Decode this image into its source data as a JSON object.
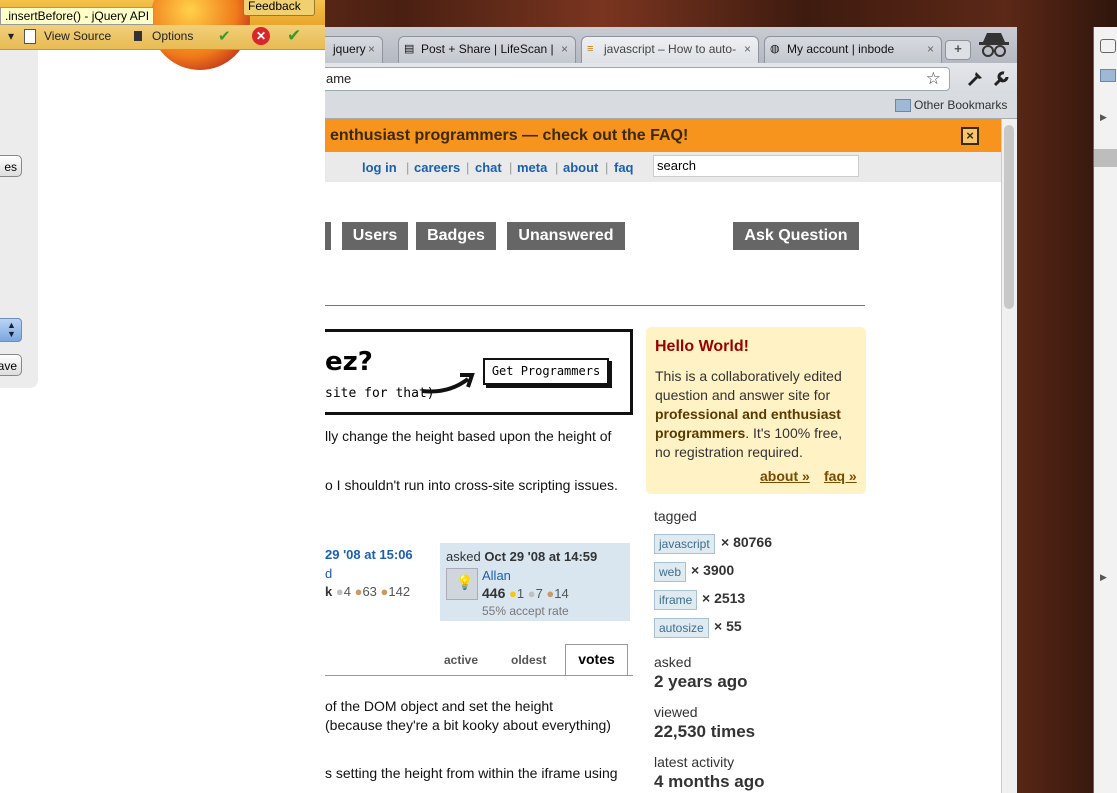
{
  "firefox": {
    "tooltip": ".insertBefore() - jQuery API",
    "feedback_label": "Feedback",
    "view_source_label": "View Source",
    "options_label": "Options",
    "panel_buttons": [
      "es",
      "ave"
    ]
  },
  "chrome": {
    "tabs": [
      {
        "title": "jquery",
        "close": "×"
      },
      {
        "title": "Post + Share | LifeScan |",
        "close": "×"
      },
      {
        "title": "javascript – How to auto-",
        "close": "×"
      },
      {
        "title": "My account | inbode",
        "close": "×"
      }
    ],
    "newtab": "+",
    "address": "ame",
    "bookmarks": {
      "other": "Other Bookmarks"
    }
  },
  "page": {
    "notify": {
      "text": "enthusiast programmers — check out the ",
      "faq": "FAQ",
      "tail": "!",
      "close": "×"
    },
    "top_links": [
      "log in",
      "careers",
      "chat",
      "meta",
      "about",
      "faq"
    ],
    "search": "search",
    "nav": {
      "users": "Users",
      "badges": "Badges",
      "unanswered": "Unanswered",
      "ask": "Ask Question"
    },
    "hero": {
      "big": "ez?",
      "small": "site for that)",
      "button": "Get Programmers"
    },
    "question": {
      "line1": "lly change the height based upon the height of",
      "line2": "o I shouldn't run into cross-site scripting issues."
    },
    "editor": {
      "when": "29 '08 at 15:06",
      "name": "d",
      "k": "k",
      "silver": "4",
      "bronze_a": "63",
      "bronze_b": "142"
    },
    "owner": {
      "asked": "asked ",
      "when": "Oct 29 '08 at 14:59",
      "name": "Allan",
      "rep": "446",
      "gold": "1",
      "silver": "7",
      "bronze": "14",
      "accept": "55% accept rate"
    },
    "tabs": {
      "active": "active",
      "oldest": "oldest",
      "votes": "votes"
    },
    "answer": {
      "line1": "of the DOM object and set the height",
      "line2": "(because they're a bit kooky about everything)",
      "line3": "s setting the height from within the iframe using"
    },
    "sidebar": {
      "title": "Hello World!",
      "body_a": "This is a collaboratively edited question and answer site for ",
      "body_bold": "professional and enthusiast programmers",
      "body_b": ". It's 100% free, no registration required.",
      "about": "about »",
      "faq": "faq »",
      "tagged": "tagged",
      "tags": [
        {
          "name": "javascript",
          "count": "× 80766"
        },
        {
          "name": "web",
          "count": "× 3900"
        },
        {
          "name": "iframe",
          "count": "× 2513"
        },
        {
          "name": "autosize",
          "count": "× 55"
        }
      ],
      "asked_label": "asked",
      "asked_value": "2 years ago",
      "viewed_label": "viewed",
      "viewed_value": "22,530 times",
      "activity_label": "latest activity",
      "activity_value": "4 months ago"
    }
  },
  "colors": {
    "accent": "#f7941d",
    "link": "#1a5fb0",
    "nav": "#666666",
    "sidebox": "#fff2c4"
  }
}
